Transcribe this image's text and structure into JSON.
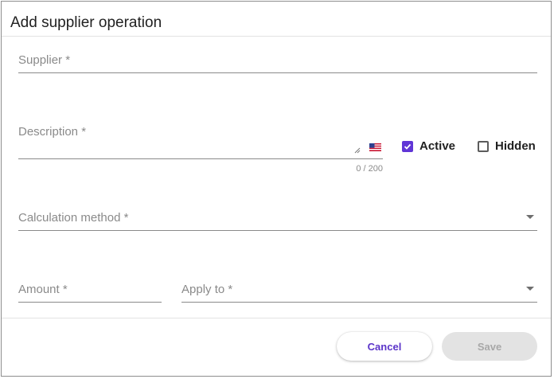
{
  "dialog": {
    "title": "Add supplier operation"
  },
  "fields": {
    "supplier": {
      "label": "Supplier *"
    },
    "description": {
      "label": "Description *",
      "counter": "0 / 200",
      "language_flag": "us-flag-icon"
    },
    "calculation_method": {
      "label": "Calculation method *"
    },
    "amount": {
      "label": "Amount *"
    },
    "apply_to": {
      "label": "Apply to *"
    }
  },
  "checkboxes": {
    "active": {
      "label": "Active",
      "checked": true
    },
    "hidden": {
      "label": "Hidden",
      "checked": false
    }
  },
  "actions": {
    "cancel_label": "Cancel",
    "save_label": "Save"
  },
  "colors": {
    "accent": "#6035d6",
    "cancel_text": "#5b34c9",
    "disabled_bg": "#e3e3e3",
    "disabled_text": "#a8a8a8"
  }
}
